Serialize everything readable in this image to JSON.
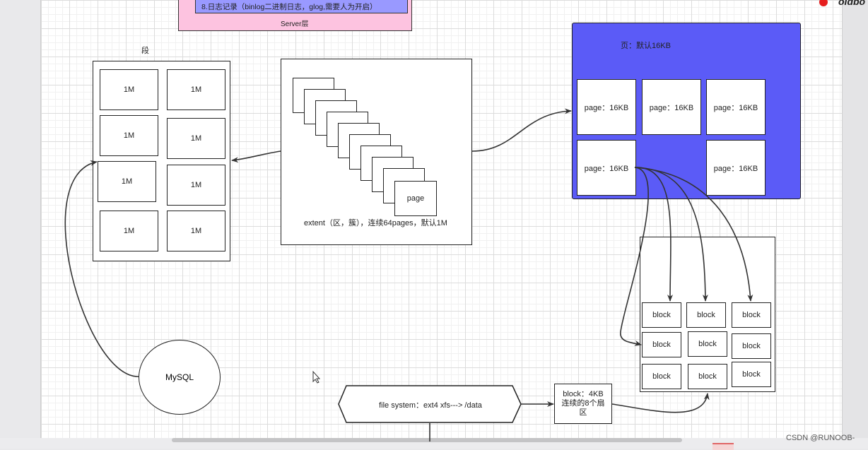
{
  "server": {
    "log_line": "8.日志记录（binlog二进制日志，glog,需要人为开启）",
    "layer_label": "Server层"
  },
  "segment": {
    "title": "段",
    "cells": [
      "1M",
      "1M",
      "1M",
      "1M",
      "1M",
      "1M",
      "1M",
      "1M"
    ]
  },
  "extent": {
    "page_label": "page",
    "caption": "extent（区，簇），连续64pages，默认1M"
  },
  "page_block": {
    "title": "页：默认16KB",
    "pages": [
      "page：16KB",
      "page：16KB",
      "page：16KB",
      "page：16KB",
      "page：16KB"
    ]
  },
  "blocks": [
    "block",
    "block",
    "block",
    "block",
    "block",
    "block",
    "block",
    "block",
    "block"
  ],
  "block_info": {
    "line1": "block：4KB",
    "line2": "连续的8个扇",
    "line3": "区"
  },
  "filesystem": {
    "label": "file system：ext4 xfs---> /data"
  },
  "mysql": {
    "label": "MySQL"
  },
  "watermark": "CSDN @RUNOOB-",
  "corner_text": "oldbo",
  "colors": {
    "page_bg": "#5b5bf7",
    "server_bg": "#fdc3e0",
    "server_inner": "#9999ff"
  }
}
